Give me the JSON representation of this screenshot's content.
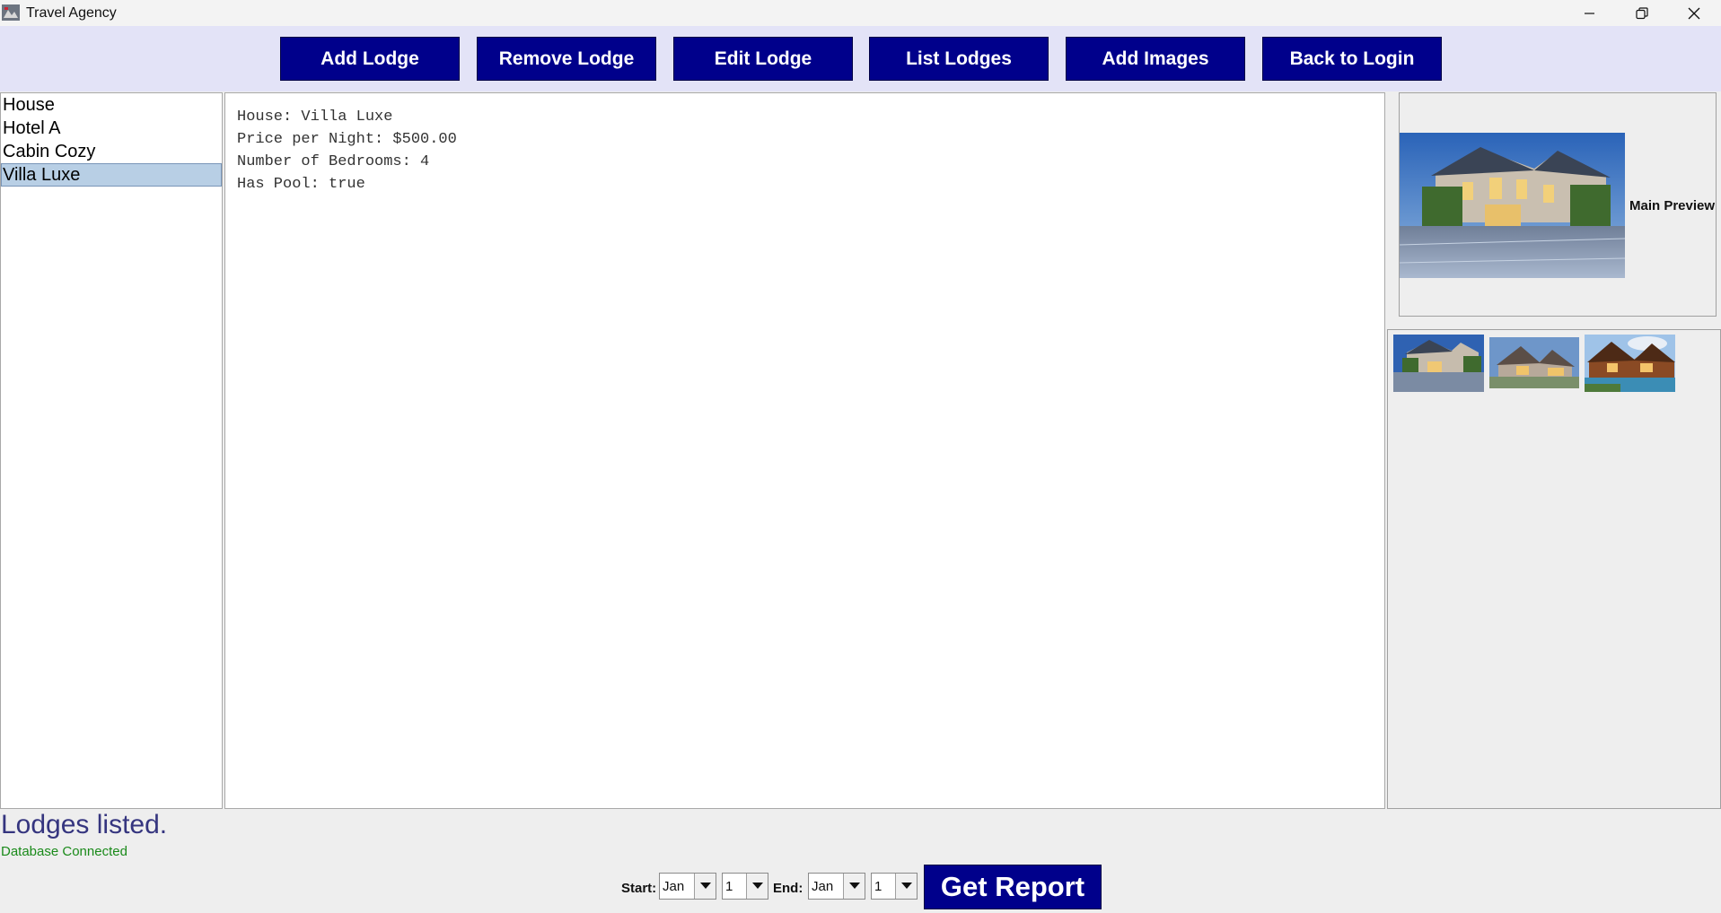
{
  "window": {
    "title": "Travel Agency"
  },
  "toolbar": {
    "buttons": [
      {
        "label": "Add Lodge"
      },
      {
        "label": "Remove Lodge"
      },
      {
        "label": "Edit Lodge"
      },
      {
        "label": "List Lodges"
      },
      {
        "label": "Add Images"
      },
      {
        "label": "Back to Login"
      }
    ]
  },
  "lodge_list": {
    "items": [
      {
        "label": "House"
      },
      {
        "label": "Hotel A"
      },
      {
        "label": "Cabin Cozy"
      },
      {
        "label": "Villa Luxe",
        "selected": true
      }
    ]
  },
  "details": {
    "lines": [
      "House: Villa Luxe",
      "Price per Night: $500.00",
      "Number of Bedrooms: 4",
      "Has Pool: true"
    ]
  },
  "preview": {
    "label": "Main Preview"
  },
  "thumbnails": {
    "count": 3
  },
  "status": {
    "message": "Lodges listed.",
    "db": "Database Connected"
  },
  "report": {
    "start_label": "Start:",
    "start_month": "Jan",
    "start_day": "1",
    "end_label": "End:",
    "end_month": "Jan",
    "end_day": "1",
    "button_label": "Get Report"
  },
  "colors": {
    "button_bg": "#00008b",
    "toolbar_bg": "#e3e3f7",
    "selection_bg": "#b8cfe5",
    "status_text": "#35357f",
    "db_text": "#1a8a1a"
  },
  "icons": {
    "app": "travel-agency-app-icon",
    "minimize": "minimize-icon",
    "restore": "restore-icon",
    "close": "close-icon",
    "dropdown": "chevron-down-icon"
  }
}
